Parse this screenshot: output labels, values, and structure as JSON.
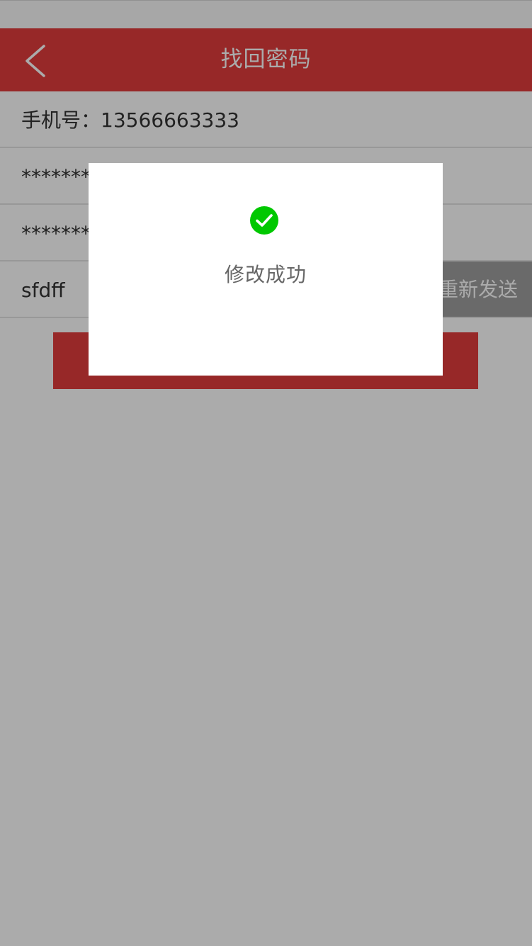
{
  "header": {
    "title": "找回密码",
    "back_icon": "chevron-left-icon"
  },
  "form": {
    "phone_text": "手机号：13566663333",
    "password_masked": "*******",
    "confirm_password_masked": "*******",
    "verification_code": "sfdff",
    "resend_label": "重新发送"
  },
  "dialog": {
    "icon": "check-circle-icon",
    "message": "修改成功"
  },
  "colors": {
    "brand_red": "#e23d3d",
    "success_green": "#00c800",
    "overlay": "rgba(0,0,0,0.33)"
  }
}
